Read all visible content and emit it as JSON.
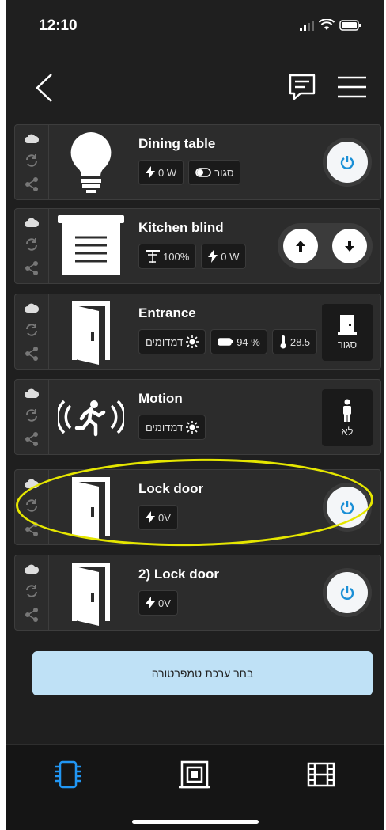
{
  "status_bar": {
    "time": "12:10"
  },
  "devices": [
    {
      "title": "Dining table",
      "chips": [
        {
          "icon": "bolt-icon",
          "text": "0 W"
        },
        {
          "icon": "toggle-icon",
          "text": "סגור"
        }
      ],
      "control": "power"
    },
    {
      "title": "Kitchen blind",
      "chips": [
        {
          "icon": "blind-level-icon",
          "text": "100%"
        },
        {
          "icon": "bolt-icon",
          "text": "0 W"
        }
      ],
      "control": "up-down"
    },
    {
      "title": "Entrance",
      "chips": [
        {
          "icon": "sun-icon",
          "text": "דמדומים"
        },
        {
          "icon": "battery-icon",
          "text": "94 %"
        },
        {
          "icon": "thermometer-icon",
          "text": "28.5"
        }
      ],
      "control": "state",
      "state_label": "סגור"
    },
    {
      "title": "Motion",
      "chips": [
        {
          "icon": "sun-icon",
          "text": "דמדומים"
        }
      ],
      "control": "state",
      "state_label": "לא"
    },
    {
      "title": "Lock door",
      "chips": [
        {
          "icon": "bolt-icon",
          "text": "0V"
        }
      ],
      "control": "power"
    },
    {
      "title": "2) Lock door",
      "chips": [
        {
          "icon": "bolt-icon",
          "text": "0V"
        }
      ],
      "control": "power"
    }
  ],
  "temperature_button": {
    "label": "בחר ערכת טמפרטורה"
  },
  "colors": {
    "accent": "#1a8fd6",
    "highlight": "#e5e600",
    "background": "#1f1f1f",
    "button": "#bfe1f6"
  },
  "tabs": [
    {
      "icon": "device-icon",
      "active": true
    },
    {
      "icon": "scene-icon",
      "active": false
    },
    {
      "icon": "film-icon",
      "active": false
    }
  ]
}
